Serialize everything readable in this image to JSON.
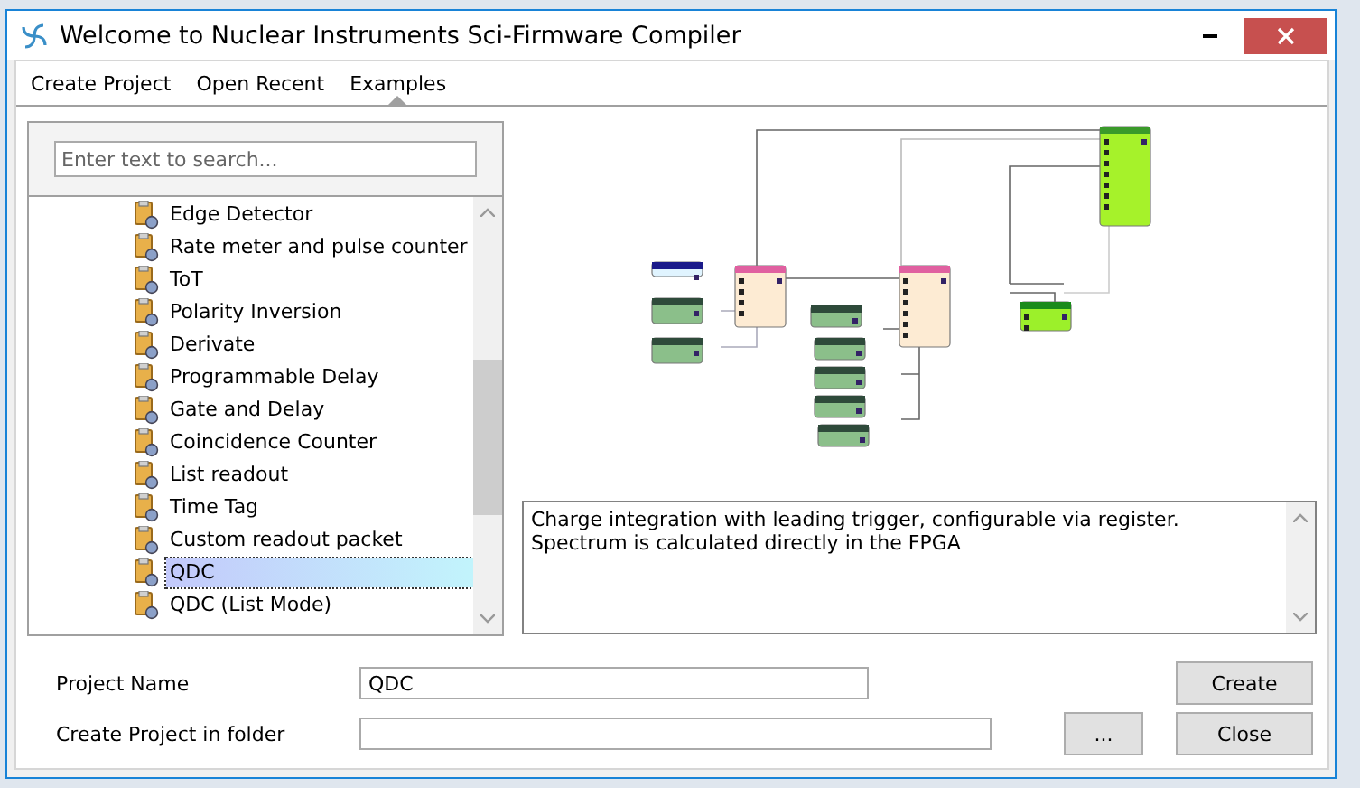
{
  "window": {
    "title": "Welcome to Nuclear Instruments  Sci-Firmware Compiler"
  },
  "tabs": [
    {
      "label": "Create Project",
      "selected": false
    },
    {
      "label": "Open Recent",
      "selected": false
    },
    {
      "label": "Examples",
      "selected": true
    }
  ],
  "search": {
    "placeholder": "Enter text to search..."
  },
  "examples": [
    {
      "label": "Edge Detector",
      "selected": false
    },
    {
      "label": "Rate meter and pulse counter",
      "selected": false
    },
    {
      "label": "ToT",
      "selected": false
    },
    {
      "label": "Polarity Inversion",
      "selected": false
    },
    {
      "label": "Derivate",
      "selected": false
    },
    {
      "label": "Programmable Delay",
      "selected": false
    },
    {
      "label": "Gate and Delay",
      "selected": false
    },
    {
      "label": "Coincidence Counter",
      "selected": false
    },
    {
      "label": "List readout",
      "selected": false
    },
    {
      "label": "Time Tag",
      "selected": false
    },
    {
      "label": "Custom readout packet",
      "selected": false
    },
    {
      "label": "QDC",
      "selected": true
    },
    {
      "label": "QDC (List Mode)",
      "selected": false
    }
  ],
  "description": "Charge integration with leading trigger, configurable via register. Spectrum is calculated directly in the FPGA",
  "form": [
    {
      "label": "Project Name",
      "value": "QDC"
    },
    {
      "label": "Create Project in folder"
    }
  ],
  "browse_button": "...",
  "buttons": [
    "Create",
    "Close"
  ]
}
